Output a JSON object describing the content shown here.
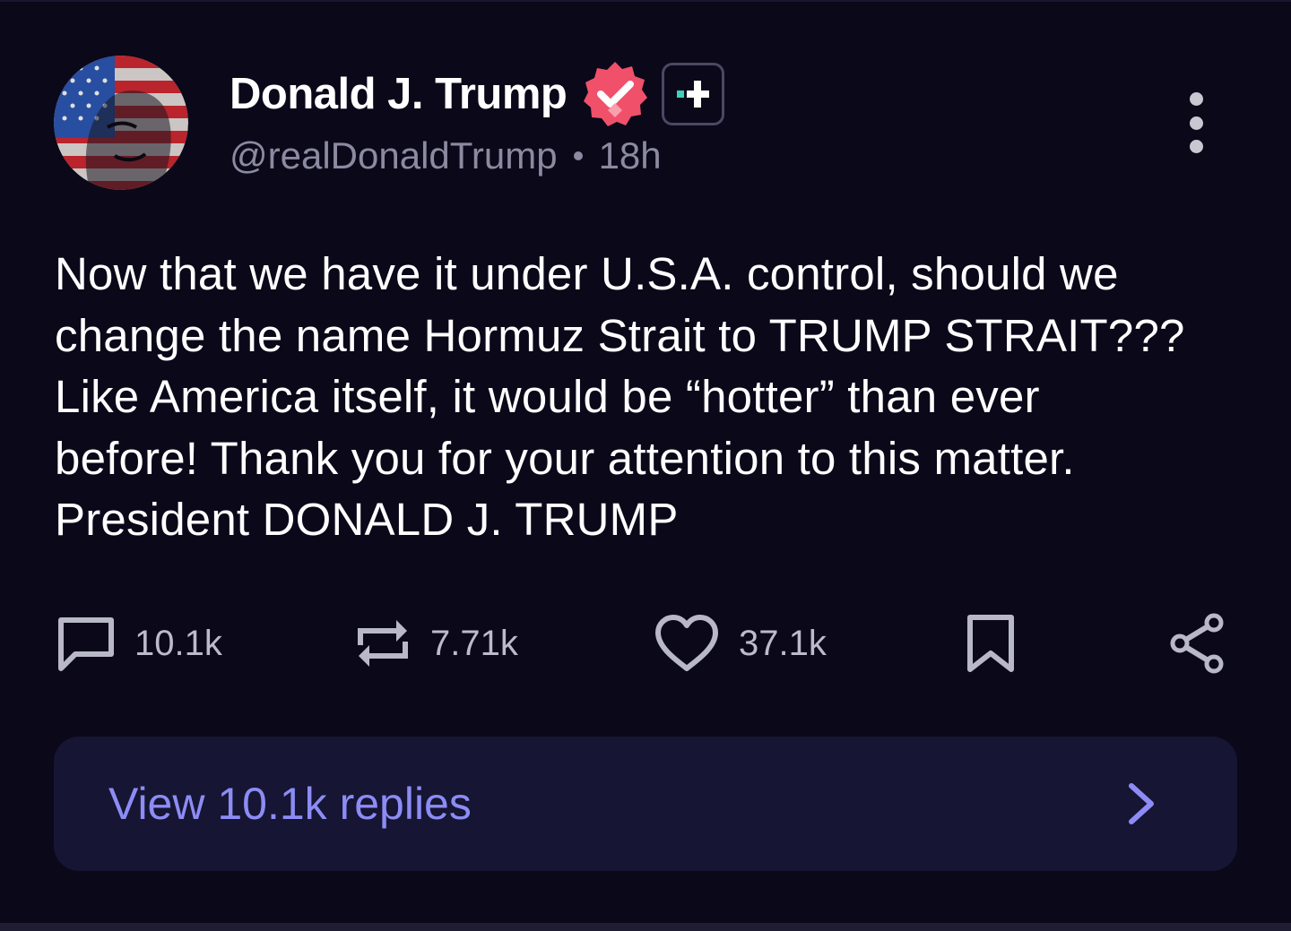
{
  "post": {
    "author": {
      "display_name": "Donald J. Trump",
      "handle": "@realDonaldTrump",
      "timestamp": "18h",
      "avatar_icon": "flag-portrait-avatar",
      "verified_icon": "verified-check-icon",
      "plus_icon": "plus-badge-icon"
    },
    "more_icon": "vertical-ellipsis-icon",
    "body_lines": [
      "Now that we have it under U.S.A. control, should we",
      "change the name Hormuz Strait to TRUMP STRAIT???",
      "Like America itself, it would be “hotter” than ever",
      "before! Thank you for your attention to this matter.",
      "President DONALD J. TRUMP"
    ],
    "actions": {
      "replies": {
        "icon": "comment-icon",
        "count": "10.1k"
      },
      "reposts": {
        "icon": "repost-icon",
        "count": "7.71k"
      },
      "likes": {
        "icon": "heart-icon",
        "count": "37.1k"
      },
      "bookmark": {
        "icon": "bookmark-icon"
      },
      "share": {
        "icon": "share-icon"
      }
    },
    "view_replies": {
      "label": "View 10.1k replies",
      "icon": "chevron-right-icon"
    }
  },
  "colors": {
    "background": "#0a0819",
    "verified_badge": "#f0506a",
    "accent_teal": "#3fd1b5",
    "link_purple": "#8d8cf5",
    "replies_bar": "#161533",
    "muted_text": "#8c8aa0"
  }
}
